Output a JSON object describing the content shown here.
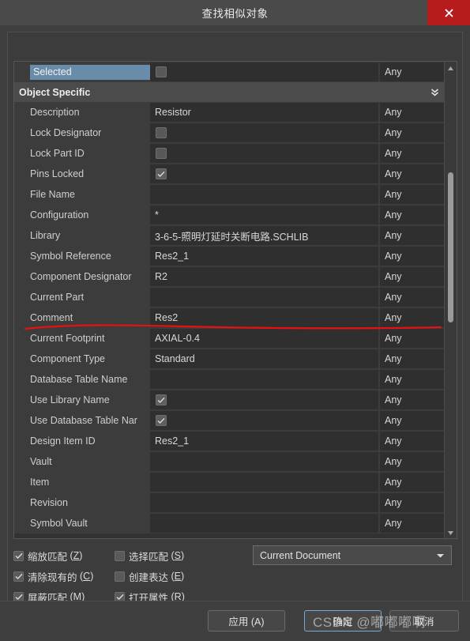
{
  "window": {
    "title": "查找相似对象",
    "close_icon": "close-icon",
    "accent_close_bg": "#b71c1c"
  },
  "grid": {
    "header_row": {
      "label": "Object Specific",
      "chevron_icon": "chevron-double-down-icon"
    },
    "selected_row": {
      "label": "Selected",
      "checkbox": false,
      "any": "Any",
      "highlight_color": "#6a8cab"
    },
    "rows": [
      {
        "label": "Description",
        "type": "text",
        "value": "Resistor",
        "any": "Any"
      },
      {
        "label": "Lock Designator",
        "type": "checkbox",
        "checked": false,
        "value": "",
        "any": "Any"
      },
      {
        "label": "Lock Part ID",
        "type": "checkbox",
        "checked": false,
        "value": "",
        "any": "Any"
      },
      {
        "label": "Pins Locked",
        "type": "checkbox",
        "checked": true,
        "value": "",
        "any": "Any"
      },
      {
        "label": "File Name",
        "type": "text",
        "value": "",
        "any": "Any"
      },
      {
        "label": "Configuration",
        "type": "text",
        "value": "*",
        "any": "Any"
      },
      {
        "label": "Library",
        "type": "text",
        "value": "3-6-5-照明灯延时关断电路.SCHLIB",
        "any": "Any"
      },
      {
        "label": "Symbol Reference",
        "type": "text",
        "value": "Res2_1",
        "any": "Any"
      },
      {
        "label": "Component Designator",
        "type": "text",
        "value": "R2",
        "any": "Any"
      },
      {
        "label": "Current Part",
        "type": "text",
        "value": "",
        "any": "Any"
      },
      {
        "label": "Comment",
        "type": "text",
        "value": "Res2",
        "any": "Any"
      },
      {
        "label": "Current Footprint",
        "type": "text",
        "value": "AXIAL-0.4",
        "any": "Any"
      },
      {
        "label": "Component Type",
        "type": "text",
        "value": "Standard",
        "any": "Any"
      },
      {
        "label": "Database Table Name",
        "type": "text",
        "value": "",
        "any": "Any"
      },
      {
        "label": "Use Library Name",
        "type": "checkbox",
        "checked": true,
        "value": "",
        "any": "Any"
      },
      {
        "label": "Use Database Table Nar",
        "type": "checkbox",
        "checked": true,
        "value": "",
        "any": "Any"
      },
      {
        "label": "Design Item ID",
        "type": "text",
        "value": "Res2_1",
        "any": "Any"
      },
      {
        "label": "Vault",
        "type": "text",
        "value": "",
        "any": "Any"
      },
      {
        "label": "Item",
        "type": "text",
        "value": "",
        "any": "Any"
      },
      {
        "label": "Revision",
        "type": "text",
        "value": "",
        "any": "Any"
      },
      {
        "label": "Symbol Vault",
        "type": "text",
        "value": "",
        "any": "Any"
      }
    ],
    "scrollbar": {
      "up_icon": "triangle-up-icon",
      "down_icon": "triangle-down-icon"
    }
  },
  "options": [
    {
      "label": "缩放匹配",
      "mnemonic": "Z",
      "checked": true
    },
    {
      "label": "选择匹配",
      "mnemonic": "S",
      "checked": false
    },
    {
      "label": "清除现有的",
      "mnemonic": "C",
      "checked": true
    },
    {
      "label": "创建表达",
      "mnemonic": "E",
      "checked": false
    },
    {
      "label": "屏蔽匹配",
      "mnemonic": "M",
      "checked": true
    },
    {
      "label": "打开属性",
      "mnemonic": "R",
      "checked": true
    }
  ],
  "scope": {
    "selected": "Current Document",
    "caret_icon": "chevron-down-icon"
  },
  "footer": {
    "apply_label": "应用 (A)",
    "ok_label": "确定",
    "cancel_label": "取消",
    "focus_color": "#7aa7d4"
  },
  "annotation": {
    "underline_color": "#e81010",
    "watermark": "CSDN @嘟嘟嘟啊"
  }
}
